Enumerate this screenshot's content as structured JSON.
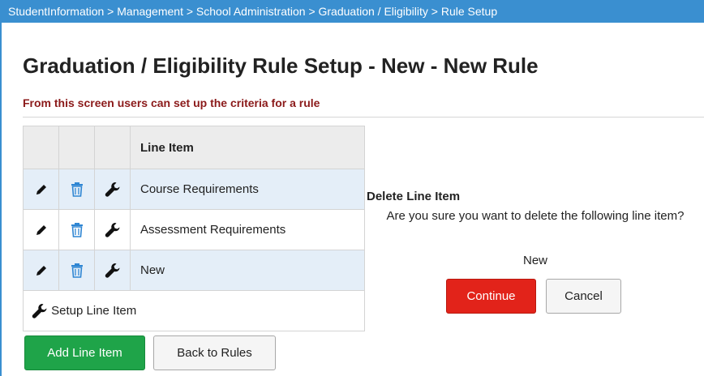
{
  "breadcrumb": "StudentInformation > Management > School Administration > Graduation / Eligibility > Rule Setup",
  "page": {
    "title": "Graduation / Eligibility Rule Setup - New - New Rule",
    "subtitle": "From this screen users can set up the criteria for a rule"
  },
  "table": {
    "header": "Line Item",
    "rows": [
      {
        "label": "Course Requirements"
      },
      {
        "label": "Assessment Requirements"
      },
      {
        "label": "New"
      }
    ],
    "footer_label": "Setup Line Item"
  },
  "buttons": {
    "add_line_item": "Add Line Item",
    "back_to_rules": "Back to Rules"
  },
  "dialog": {
    "title": "Delete Line Item",
    "message": "Are you sure you want to delete the following line item?",
    "item_name": "New",
    "continue_label": "Continue",
    "cancel_label": "Cancel"
  },
  "colors": {
    "breadcrumb_bg": "#3a8fd0",
    "subtitle": "#8b1a1a",
    "row_highlight": "#e4eef8",
    "add_button": "#1fa449",
    "continue_button": "#e2231a",
    "trash_icon": "#2f86d3"
  },
  "icons": [
    "pencil-icon",
    "trash-icon",
    "wrench-icon"
  ]
}
